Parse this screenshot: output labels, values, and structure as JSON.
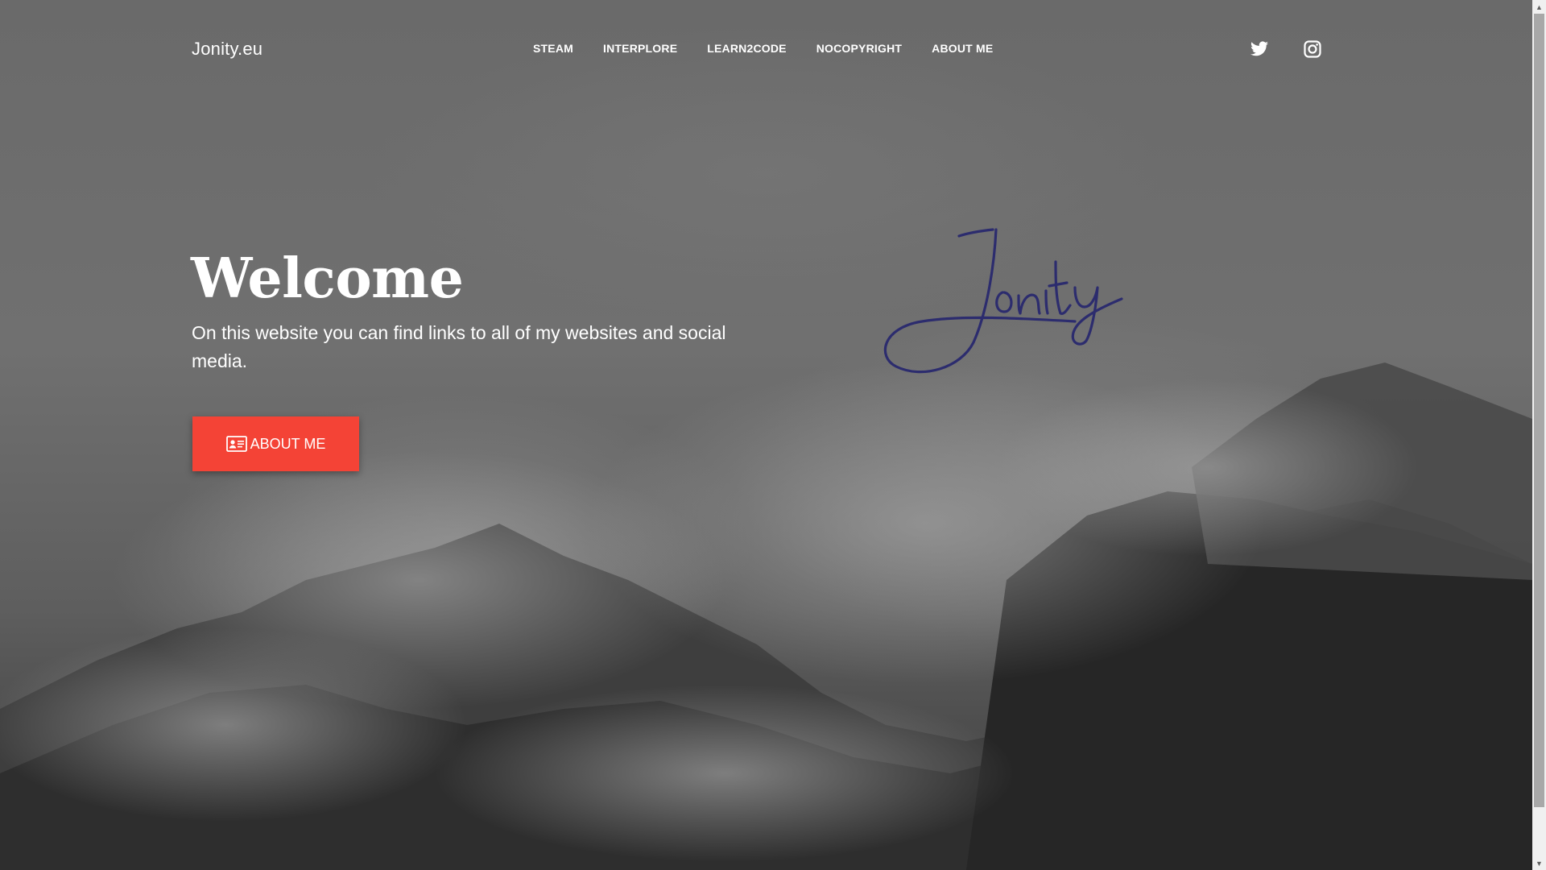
{
  "brand": "Jonity.eu",
  "nav": {
    "items": [
      {
        "label": "STEAM"
      },
      {
        "label": "INTERPLORE"
      },
      {
        "label": "LEARN2CODE"
      },
      {
        "label": "NOCOPYRIGHT"
      },
      {
        "label": "ABOUT ME"
      }
    ]
  },
  "social": [
    "twitter-icon",
    "instagram-icon"
  ],
  "hero": {
    "title": "Welcome",
    "subtitle": "On this website you can find links to all of my websites and social media.",
    "button_label": "ABOUT ME",
    "button_icon": "id-card-icon",
    "signature": "Jonity"
  },
  "colors": {
    "accent": "#f44336",
    "signature": "#2c2c6e",
    "text": "#ffffff"
  }
}
